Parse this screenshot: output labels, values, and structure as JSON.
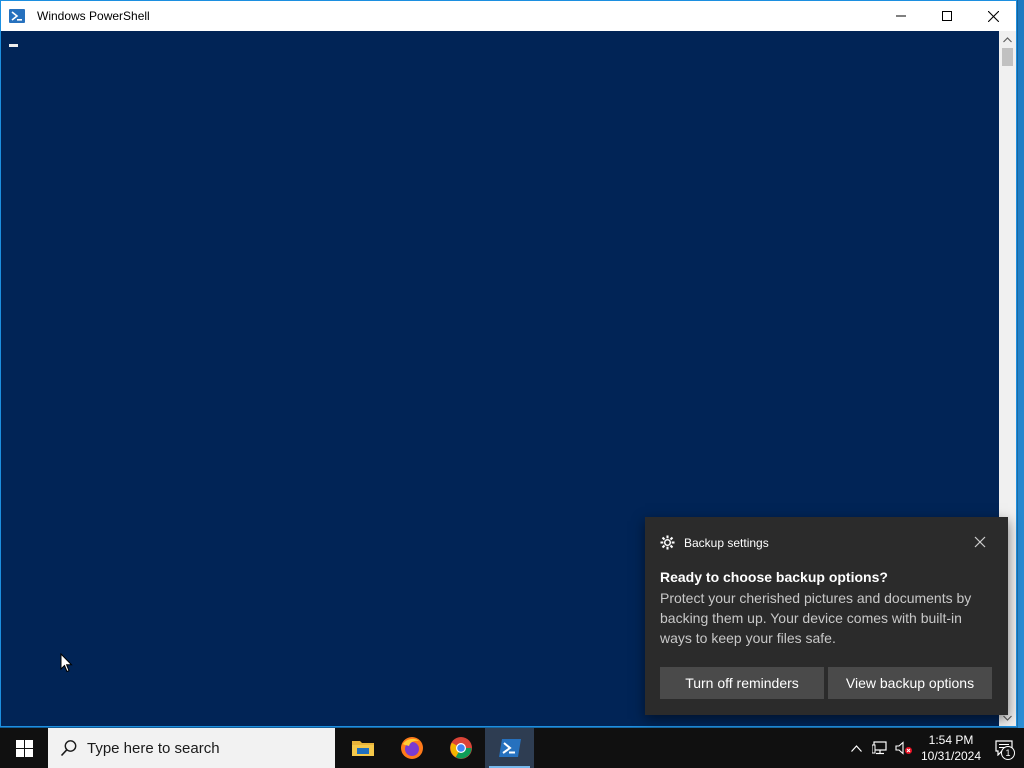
{
  "window": {
    "title": "Windows PowerShell",
    "background": "#012456"
  },
  "toast": {
    "app_name": "Backup settings",
    "title": "Ready to choose backup options?",
    "body": "Protect your cherished pictures and documents by backing them up. Your device comes with built-in ways to keep your files safe.",
    "buttons": [
      "Turn off reminders",
      "View backup options"
    ]
  },
  "taskbar": {
    "search_placeholder": "Type here to search",
    "apps": [
      {
        "name": "file-explorer",
        "active": false
      },
      {
        "name": "firefox",
        "active": false
      },
      {
        "name": "chrome",
        "active": false
      },
      {
        "name": "powershell",
        "active": true
      }
    ],
    "clock": {
      "time": "1:54 PM",
      "date": "10/31/2024"
    },
    "notification_count": "1"
  }
}
